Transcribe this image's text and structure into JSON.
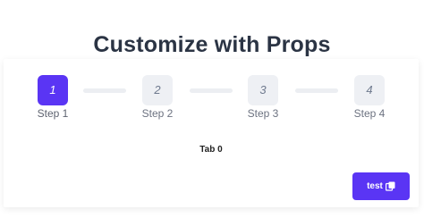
{
  "header": {
    "title": "Customize with Props"
  },
  "stepper": {
    "active_index": 0,
    "steps": [
      {
        "number": "1",
        "label": "Step 1"
      },
      {
        "number": "2",
        "label": "Step 2"
      },
      {
        "number": "3",
        "label": "Step 3"
      },
      {
        "number": "4",
        "label": "Step 4"
      }
    ]
  },
  "content": {
    "tab_text": "Tab 0"
  },
  "actions": {
    "test_label": "test",
    "test_icon": "copy-icon"
  },
  "colors": {
    "accent": "#5a35f4",
    "inactive_step": "#eef0f4",
    "title": "#2b3444"
  }
}
